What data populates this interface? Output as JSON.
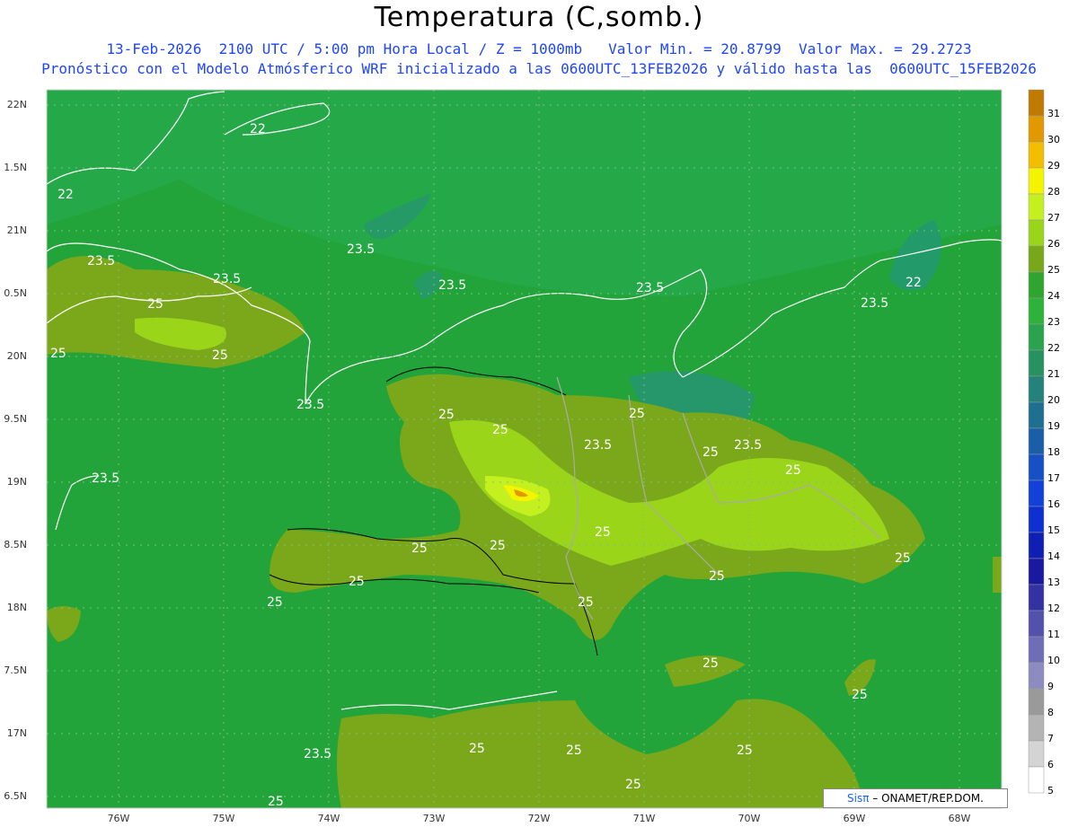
{
  "header": {
    "title": "Temperatura (C,somb.)",
    "line1": "13-Feb-2026  2100 UTC / 5:00 pm Hora Local / Z = 1000mb   Valor Min. = 20.8799  Valor Max. = 29.2723",
    "line2": "Pronóstico con el Modelo Atmósferico WRF inicializado a las 0600UTC_13FEB2026 y válido hasta las  0600UTC_15FEB2026"
  },
  "axes": {
    "lat_labels": [
      "22N",
      "1.5N",
      "21N",
      "0.5N",
      "20N",
      "9.5N",
      "19N",
      "8.5N",
      "18N",
      "7.5N",
      "17N",
      "6.5N"
    ],
    "lon_labels": [
      "76W",
      "75W",
      "74W",
      "73W",
      "72W",
      "71W",
      "70W",
      "69W",
      "68W"
    ]
  },
  "colorbar": {
    "levels": [
      "31",
      "30",
      "29",
      "28",
      "27",
      "26",
      "25",
      "24",
      "23",
      "22",
      "21",
      "20",
      "19",
      "18",
      "17",
      "16",
      "15",
      "14",
      "13",
      "12",
      "11",
      "10",
      "9",
      "8",
      "7",
      "6",
      "5"
    ],
    "colors": [
      "#c07a00",
      "#e09a00",
      "#f4be00",
      "#f4f400",
      "#c4f020",
      "#9ad51a",
      "#78a81a",
      "#2fa52f",
      "#2db33a",
      "#2aa34f",
      "#27925f",
      "#24827a",
      "#1f7090",
      "#1a5ea8",
      "#1550c4",
      "#1240d8",
      "#0f30d0",
      "#0f1fb4",
      "#1a18a0",
      "#3232a0",
      "#5252ac",
      "#6e6eb8",
      "#8c8cc0",
      "#9a9a9a",
      "#b4b4b4",
      "#d4d4d4",
      "#ffffff"
    ]
  },
  "contour_labels": [
    "22",
    "22",
    "23.5",
    "23.5",
    "23.5",
    "23.5",
    "23.5",
    "23.5",
    "23.5",
    "23.5",
    "25",
    "25",
    "25",
    "25",
    "25",
    "25",
    "25",
    "25",
    "25",
    "25",
    "25",
    "25",
    "25",
    "25",
    "25",
    "25",
    "25",
    "22",
    "23.5",
    "23.5"
  ],
  "credit": {
    "brand": "Sisπ",
    "text": "– ONAMET/REP.DOM."
  }
}
